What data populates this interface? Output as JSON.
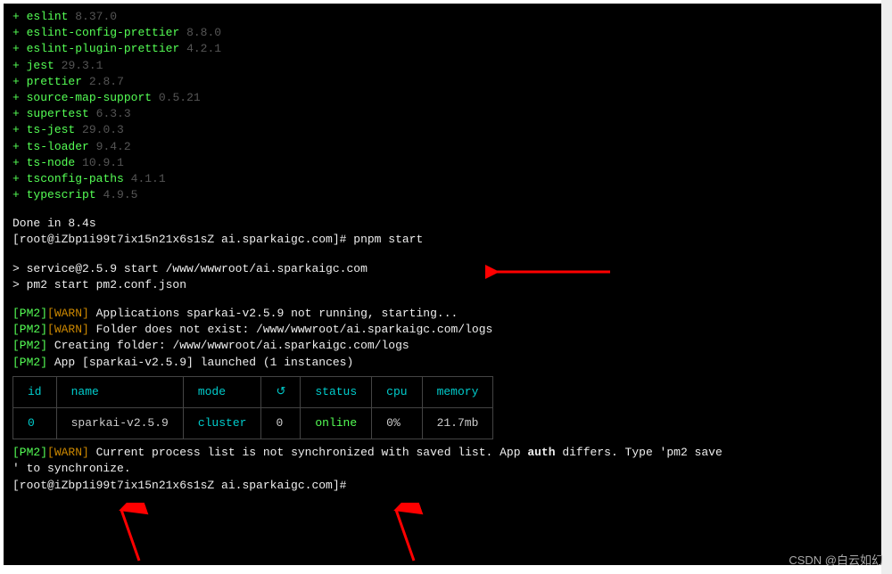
{
  "deps": [
    {
      "name": "eslint",
      "ver": "8.37.0"
    },
    {
      "name": "eslint-config-prettier",
      "ver": "8.8.0"
    },
    {
      "name": "eslint-plugin-prettier",
      "ver": "4.2.1"
    },
    {
      "name": "jest",
      "ver": "29.3.1"
    },
    {
      "name": "prettier",
      "ver": "2.8.7"
    },
    {
      "name": "source-map-support",
      "ver": "0.5.21"
    },
    {
      "name": "supertest",
      "ver": "6.3.3"
    },
    {
      "name": "ts-jest",
      "ver": "29.0.3"
    },
    {
      "name": "ts-loader",
      "ver": "9.4.2"
    },
    {
      "name": "ts-node",
      "ver": "10.9.1"
    },
    {
      "name": "tsconfig-paths",
      "ver": "4.1.1"
    },
    {
      "name": "typescript",
      "ver": "4.9.5"
    }
  ],
  "done_line": "Done in 8.4s",
  "prompt1_prefix": "[root@iZbp1i99t7ix15n21x6s1sZ ai.sparkaigc.com]# ",
  "prompt1_cmd": "pnpm start",
  "start_line1": "> service@2.5.9 start /www/wwwroot/ai.sparkaigc.com",
  "start_line2": "> pm2 start pm2.conf.json",
  "pm2": {
    "tag": "[PM2]",
    "warn": "[WARN]",
    "l1": " Applications sparkai-v2.5.9 not running, starting...",
    "l2": " Folder does not exist: /www/wwwroot/ai.sparkaigc.com/logs",
    "l3": " Creating folder: /www/wwwroot/ai.sparkaigc.com/logs",
    "l4": " App [sparkai-v2.5.9] launched (1 instances)"
  },
  "table": {
    "headers": [
      "id",
      "name",
      "mode",
      "↺",
      "status",
      "cpu",
      "memory"
    ],
    "row": {
      "id": "0",
      "name": "sparkai-v2.5.9",
      "mode": "cluster",
      "restarts": "0",
      "status": "online",
      "cpu": "0%",
      "memory": "21.7mb"
    }
  },
  "sync_line_a": " Current process list is not synchronized with saved list. App ",
  "sync_bold": "auth",
  "sync_line_b": " differs. Type 'pm2 save",
  "sync_line2": "' to synchronize.",
  "prompt2": "[root@iZbp1i99t7ix15n21x6s1sZ ai.sparkaigc.com]#",
  "watermark": "CSDN @白云如幻"
}
